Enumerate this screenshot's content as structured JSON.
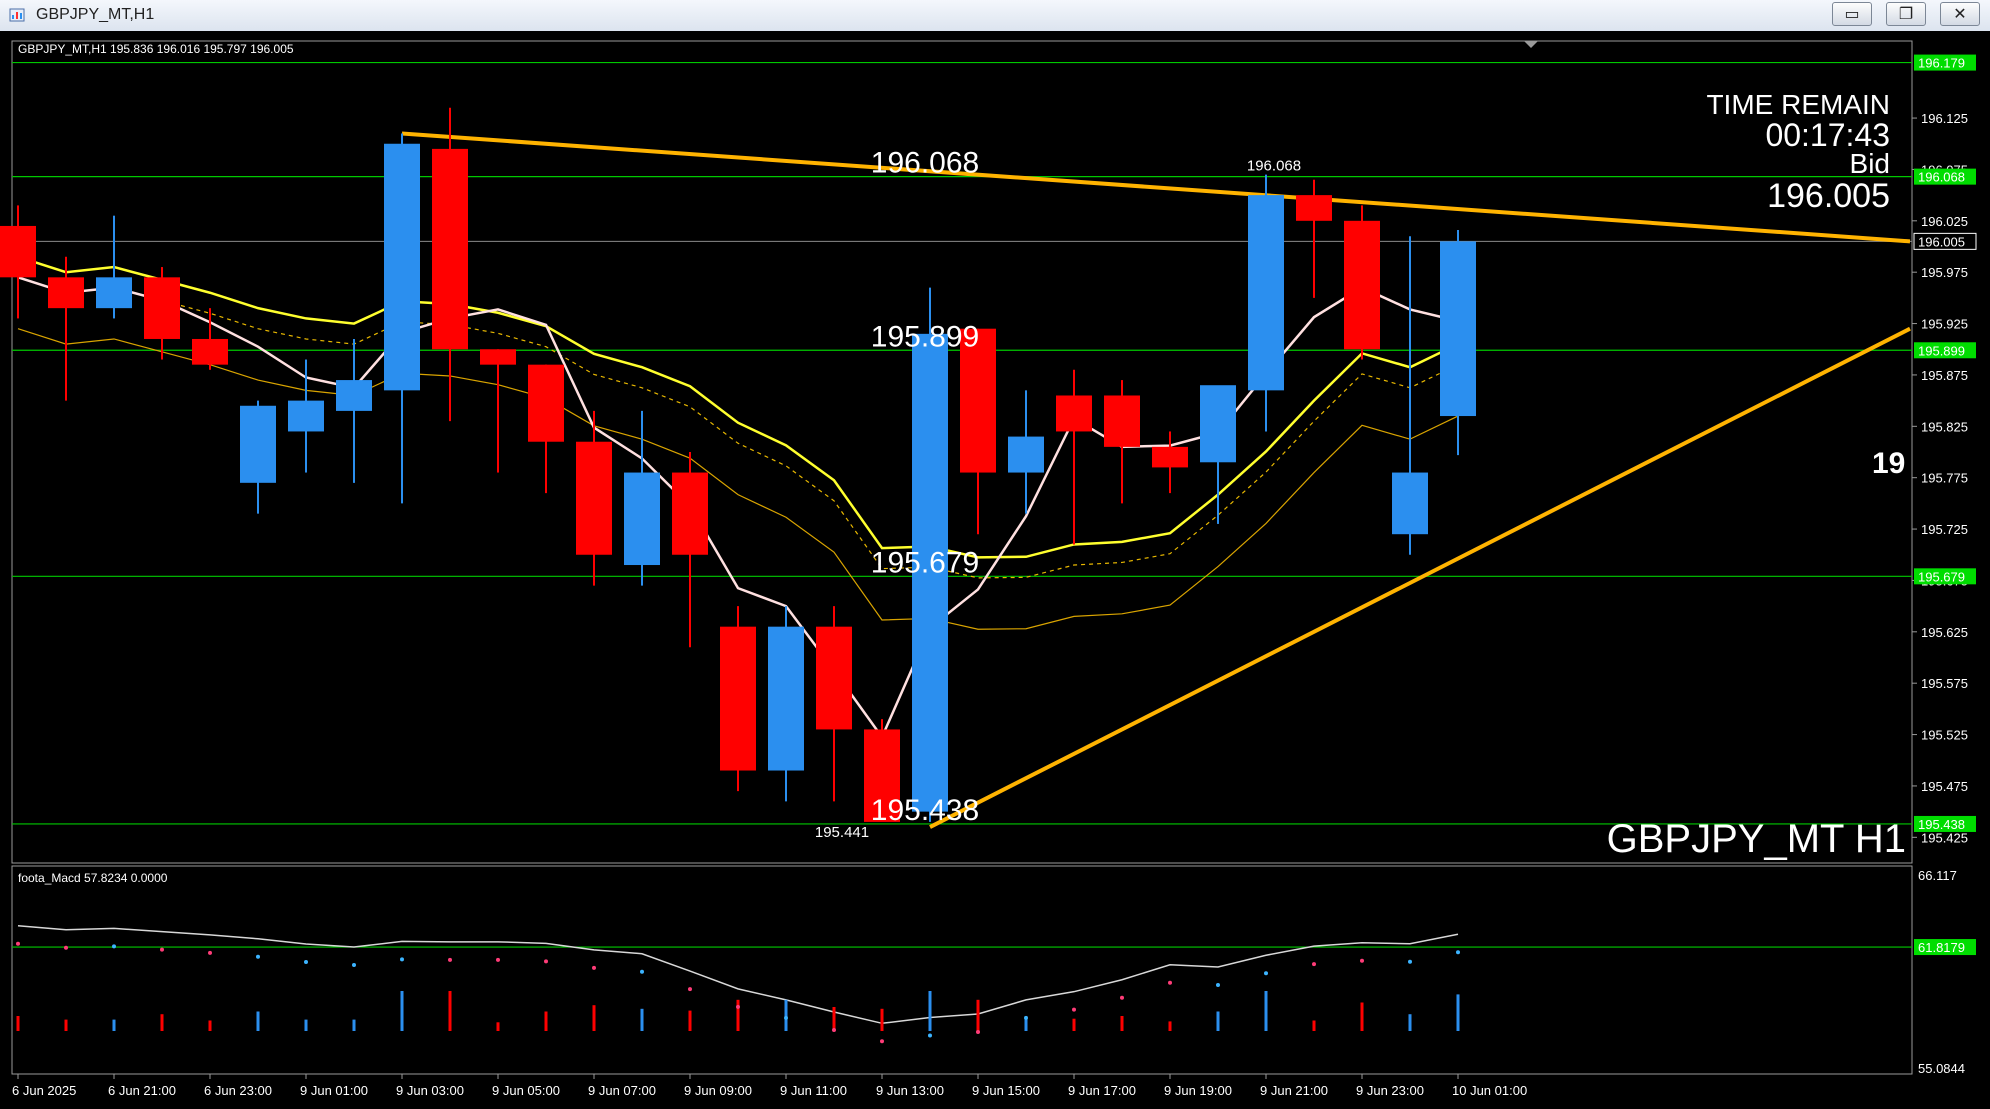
{
  "window": {
    "title": "GBPJPY_MT,H1",
    "minimize_label": "▭",
    "maximize_label": "❐",
    "close_label": "✕"
  },
  "header": {
    "info": "GBPJPY_MT,H1  195.836 196.016 195.797 196.005"
  },
  "timer": {
    "label": "TIME REMAIN",
    "value": "00:17:43",
    "bid_label": "Bid",
    "bid_value": "196.005"
  },
  "watermark": "GBPJPY_MT H1",
  "partial_right_text": "19",
  "indicator": {
    "name": "foota_Macd 57.8234  0.0000"
  },
  "colors": {
    "bull": "#2b8fef",
    "bear": "#ff0000",
    "level_line": "#00c800",
    "trend_line": "#ffb300",
    "yellow": "#ffff2e",
    "price_tag_bg": "#00dd00",
    "axis_text": "#ffffff"
  },
  "chart_data": {
    "type": "candlestick",
    "y_range": [
      195.4,
      196.2
    ],
    "x_labels": [
      "6 Jun 2025",
      "6 Jun 21:00",
      "6 Jun 23:00",
      "9 Jun 01:00",
      "9 Jun 03:00",
      "9 Jun 05:00",
      "9 Jun 07:00",
      "9 Jun 09:00",
      "9 Jun 11:00",
      "9 Jun 13:00",
      "9 Jun 15:00",
      "9 Jun 17:00",
      "9 Jun 19:00",
      "9 Jun 21:00",
      "9 Jun 23:00",
      "10 Jun 01:00"
    ],
    "y_ticks": [
      "195.425",
      "195.475",
      "195.525",
      "195.575",
      "195.625",
      "195.675",
      "195.725",
      "195.775",
      "195.825",
      "195.875",
      "195.925",
      "195.975",
      "196.025",
      "196.075",
      "196.125"
    ],
    "candles": [
      {
        "o": 196.02,
        "h": 196.04,
        "l": 195.93,
        "c": 195.97
      },
      {
        "o": 195.97,
        "h": 195.99,
        "l": 195.85,
        "c": 195.94
      },
      {
        "o": 195.94,
        "h": 196.03,
        "l": 195.93,
        "c": 195.97
      },
      {
        "o": 195.97,
        "h": 195.98,
        "l": 195.89,
        "c": 195.91
      },
      {
        "o": 195.91,
        "h": 195.94,
        "l": 195.88,
        "c": 195.885
      },
      {
        "o": 195.77,
        "h": 195.85,
        "l": 195.74,
        "c": 195.845
      },
      {
        "o": 195.82,
        "h": 195.89,
        "l": 195.78,
        "c": 195.85
      },
      {
        "o": 195.84,
        "h": 195.91,
        "l": 195.77,
        "c": 195.87
      },
      {
        "o": 195.86,
        "h": 196.11,
        "l": 195.75,
        "c": 196.1
      },
      {
        "o": 196.095,
        "h": 196.135,
        "l": 195.83,
        "c": 195.9
      },
      {
        "o": 195.9,
        "h": 195.9,
        "l": 195.78,
        "c": 195.885
      },
      {
        "o": 195.885,
        "h": 195.885,
        "l": 195.76,
        "c": 195.81
      },
      {
        "o": 195.81,
        "h": 195.84,
        "l": 195.67,
        "c": 195.7
      },
      {
        "o": 195.69,
        "h": 195.84,
        "l": 195.67,
        "c": 195.78
      },
      {
        "o": 195.78,
        "h": 195.8,
        "l": 195.61,
        "c": 195.7
      },
      {
        "o": 195.63,
        "h": 195.65,
        "l": 195.47,
        "c": 195.49
      },
      {
        "o": 195.49,
        "h": 195.65,
        "l": 195.46,
        "c": 195.63
      },
      {
        "o": 195.63,
        "h": 195.65,
        "l": 195.46,
        "c": 195.53
      },
      {
        "o": 195.53,
        "h": 195.54,
        "l": 195.45,
        "c": 195.44
      },
      {
        "o": 195.45,
        "h": 195.96,
        "l": 195.44,
        "c": 195.915
      },
      {
        "o": 195.92,
        "h": 195.92,
        "l": 195.72,
        "c": 195.78
      },
      {
        "o": 195.78,
        "h": 195.86,
        "l": 195.74,
        "c": 195.815
      },
      {
        "o": 195.855,
        "h": 195.88,
        "l": 195.71,
        "c": 195.82
      },
      {
        "o": 195.855,
        "h": 195.87,
        "l": 195.75,
        "c": 195.805
      },
      {
        "o": 195.805,
        "h": 195.82,
        "l": 195.76,
        "c": 195.785
      },
      {
        "o": 195.79,
        "h": 195.835,
        "l": 195.73,
        "c": 195.865
      },
      {
        "o": 195.86,
        "h": 196.07,
        "l": 195.82,
        "c": 196.05
      },
      {
        "o": 196.05,
        "h": 196.065,
        "l": 195.95,
        "c": 196.025
      },
      {
        "o": 196.025,
        "h": 196.04,
        "l": 195.89,
        "c": 195.9
      },
      {
        "o": 195.72,
        "h": 196.01,
        "l": 195.7,
        "c": 195.78
      },
      {
        "o": 195.835,
        "h": 196.016,
        "l": 195.797,
        "c": 196.005
      }
    ],
    "levels": [
      {
        "price": 196.179,
        "label": "196.179"
      },
      {
        "price": 196.068,
        "label": "196.068"
      },
      {
        "price": 195.899,
        "label": "195.899"
      },
      {
        "price": 195.679,
        "label": "195.679"
      },
      {
        "price": 195.438,
        "label": "195.438"
      }
    ],
    "current_price": {
      "price": 196.005,
      "label": "196.005"
    },
    "high_marker": {
      "index": 27,
      "price": 196.068,
      "label": "196.068"
    },
    "low_marker": {
      "index": 18,
      "price": 195.441,
      "label": "195.441"
    },
    "indicator_panel": {
      "y_range": [
        55.0844,
        66.117
      ],
      "top_label": "66.117",
      "bottom_label": "55.0844",
      "level": 61.8179,
      "level_label": "61.8179"
    }
  }
}
